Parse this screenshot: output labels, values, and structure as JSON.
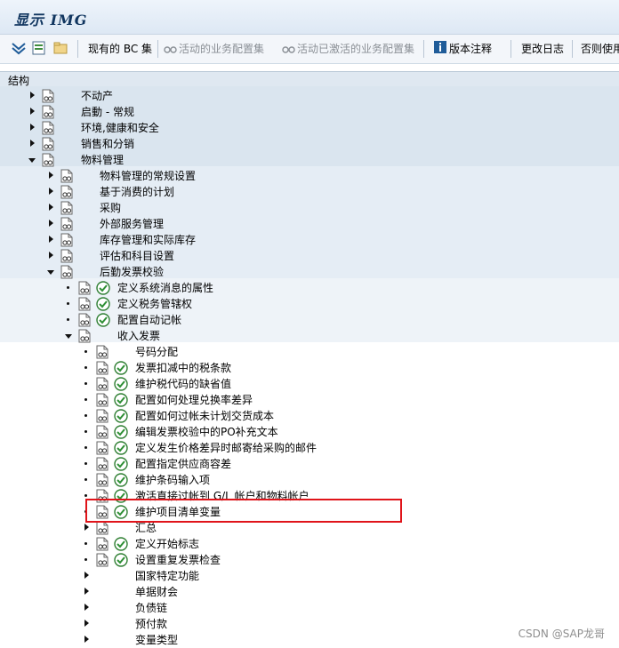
{
  "window": {
    "title": "显示 IMG"
  },
  "toolbar": {
    "existing_bc_sets": "现有的 BC 集",
    "activity_bc_sets": "活动的业务配置集",
    "activated_bc_sets": "活动已激活的业务配置集",
    "release_notes": "版本注释",
    "change_log": "更改日志",
    "where_used": "否则使用"
  },
  "tree": {
    "header": "结构",
    "nodes": [
      {
        "label": "不动产",
        "level": 0,
        "state": "collapsed",
        "exec": false
      },
      {
        "label": "启動 - 常规",
        "level": 0,
        "state": "collapsed",
        "exec": false
      },
      {
        "label": "环境,健康和安全",
        "level": 0,
        "state": "collapsed",
        "exec": false
      },
      {
        "label": "销售和分销",
        "level": 0,
        "state": "collapsed",
        "exec": false
      },
      {
        "label": "物料管理",
        "level": 0,
        "state": "expanded",
        "exec": false
      },
      {
        "label": "物料管理的常规设置",
        "level": 1,
        "state": "collapsed",
        "exec": false
      },
      {
        "label": "基于消费的计划",
        "level": 1,
        "state": "collapsed",
        "exec": false
      },
      {
        "label": "采购",
        "level": 1,
        "state": "collapsed",
        "exec": false
      },
      {
        "label": "外部服务管理",
        "level": 1,
        "state": "collapsed",
        "exec": false
      },
      {
        "label": "库存管理和实际库存",
        "level": 1,
        "state": "collapsed",
        "exec": false
      },
      {
        "label": "评估和科目设置",
        "level": 1,
        "state": "collapsed",
        "exec": false
      },
      {
        "label": "后勤发票校验",
        "level": 1,
        "state": "expanded",
        "exec": false
      },
      {
        "label": "定义系统消息的属性",
        "level": 2,
        "state": "leaf",
        "exec": true
      },
      {
        "label": "定义税务管辖权",
        "level": 2,
        "state": "leaf",
        "exec": true
      },
      {
        "label": "配置自动记帐",
        "level": 2,
        "state": "leaf",
        "exec": true
      },
      {
        "label": "收入发票",
        "level": 2,
        "state": "expanded",
        "exec": false
      },
      {
        "label": "号码分配",
        "level": 3,
        "state": "leaf",
        "exec": false
      },
      {
        "label": "发票扣减中的税条款",
        "level": 3,
        "state": "leaf",
        "exec": true
      },
      {
        "label": "维护税代码的缺省值",
        "level": 3,
        "state": "leaf",
        "exec": true
      },
      {
        "label": "配置如何处理兑换率差异",
        "level": 3,
        "state": "leaf",
        "exec": true
      },
      {
        "label": "配置如何过帐未计划交货成本",
        "level": 3,
        "state": "leaf",
        "exec": true
      },
      {
        "label": "编辑发票校验中的PO补充文本",
        "level": 3,
        "state": "leaf",
        "exec": true
      },
      {
        "label": "定义发生价格差异时邮寄给采购的邮件",
        "level": 3,
        "state": "leaf",
        "exec": true
      },
      {
        "label": "配置指定供应商容差",
        "level": 3,
        "state": "leaf",
        "exec": true
      },
      {
        "label": "维护条码输入项",
        "level": 3,
        "state": "leaf",
        "exec": true
      },
      {
        "label": "激活直接过帐到 G/L 帐户和物料帐户",
        "level": 3,
        "state": "leaf",
        "exec": true
      },
      {
        "label": "维护项目清单变量",
        "level": 3,
        "state": "leaf",
        "exec": true
      },
      {
        "label": "汇总",
        "level": 3,
        "state": "collapsed",
        "exec": false
      },
      {
        "label": "定义开始标志",
        "level": 3,
        "state": "leaf",
        "exec": true
      },
      {
        "label": "设置重复发票检查",
        "level": 3,
        "state": "leaf",
        "exec": true
      },
      {
        "label": "国家特定功能",
        "level": 3,
        "state": "collapsed-nodoc",
        "exec": false
      },
      {
        "label": "单据财会",
        "level": 3,
        "state": "collapsed-nodoc",
        "exec": false
      },
      {
        "label": "负债链",
        "level": 3,
        "state": "collapsed-nodoc",
        "exec": false
      },
      {
        "label": "预付款",
        "level": 3,
        "state": "collapsed-nodoc",
        "exec": false
      },
      {
        "label": "变量类型",
        "level": 3,
        "state": "collapsed-nodoc",
        "exec": false
      }
    ]
  },
  "colors": {
    "highlight": "#e0141a",
    "exec_green": "#3c9a3c"
  },
  "watermark": "CSDN @SAP龙哥"
}
